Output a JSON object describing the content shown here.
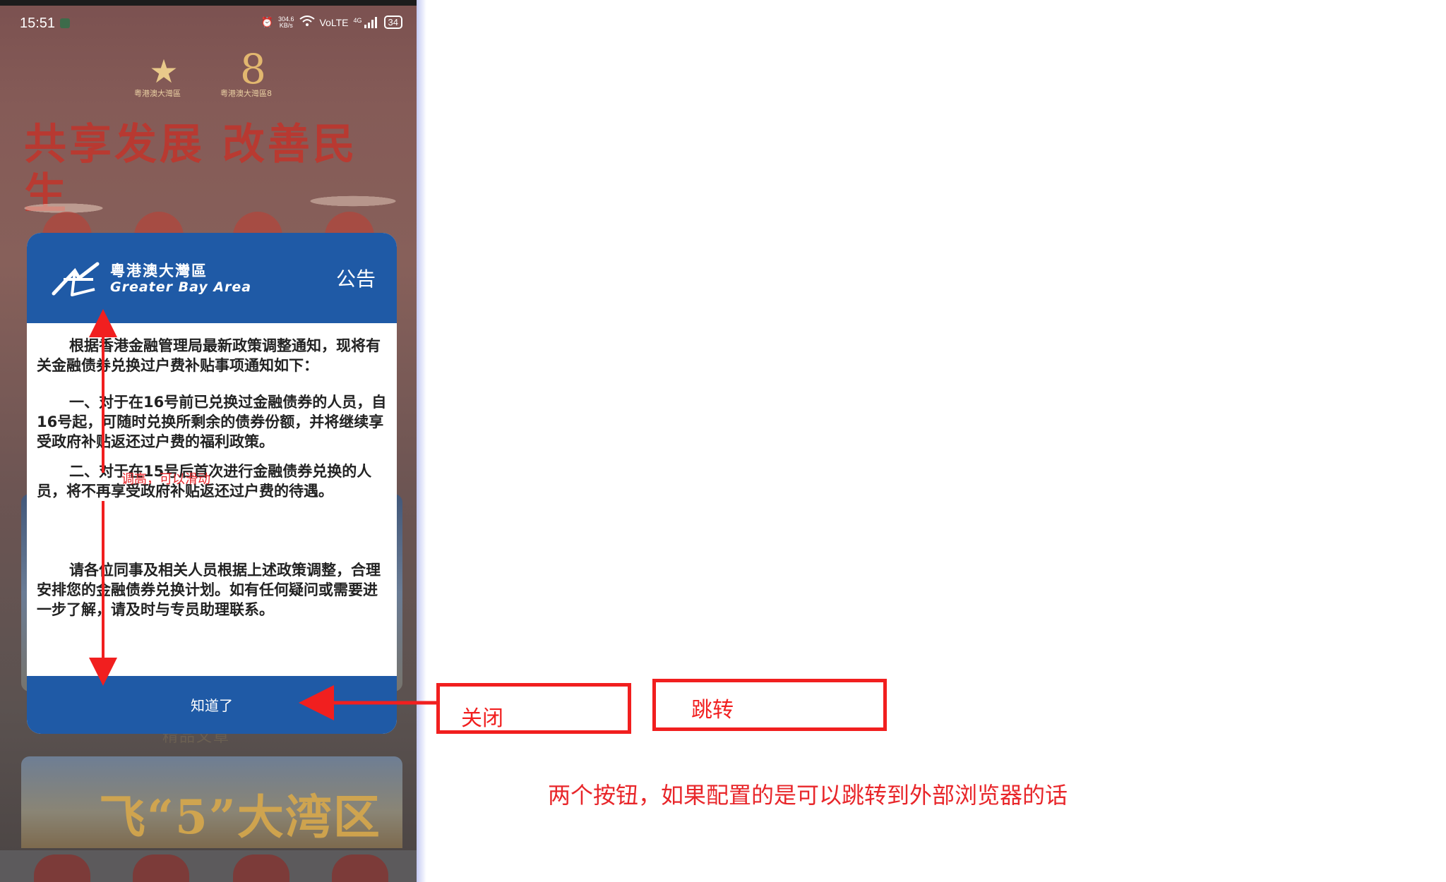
{
  "status_bar": {
    "time": "15:51",
    "net_speed_value": "304.6",
    "net_speed_unit": "KB/s",
    "network": "VoLTE",
    "signal": "4G",
    "battery": "34"
  },
  "background": {
    "slogan": "共享发展 改善民生",
    "logo_left_caption": "粤港澳大灣區",
    "logo_right_caption": "粤港澳大灣區8",
    "mid_text": "精品文章",
    "banner_text": "飞“5”大湾区"
  },
  "dialog": {
    "logo_cn": "粵港澳大灣區",
    "logo_en": "Greater Bay Area",
    "title": "公告",
    "paragraph_1": "根据香港金融管理局最新政策调整通知，现将有关金融债券兑换过户费补贴事项通知如下：",
    "paragraph_2": "一、对于在16号前已兑换过金融债券的人员，自16号起，可随时兑换所剩余的债券份额，并将继续享受政府补贴返还过户费的福利政策。",
    "paragraph_3": "二、对于在15号后首次进行金融债券兑换的人员，将不再享受政府补贴返还过户费的待遇。",
    "paragraph_4": "请各位同事及相关人员根据上述政策调整，合理安排您的金融债券兑换计划。如有任何疑问或需要进一步了解，请及时与专员助理联系。",
    "ok_button": "知道了"
  },
  "annotations": {
    "scroll_note": "调高，可以滑动",
    "close_box": "关闭",
    "jump_box": "跳转",
    "bottom_note": "两个按钮，如果配置的是可以跳转到外部浏览器的话"
  },
  "colors": {
    "dialog_blue": "#1f5aa6",
    "annotation_red": "#f11f1f"
  }
}
